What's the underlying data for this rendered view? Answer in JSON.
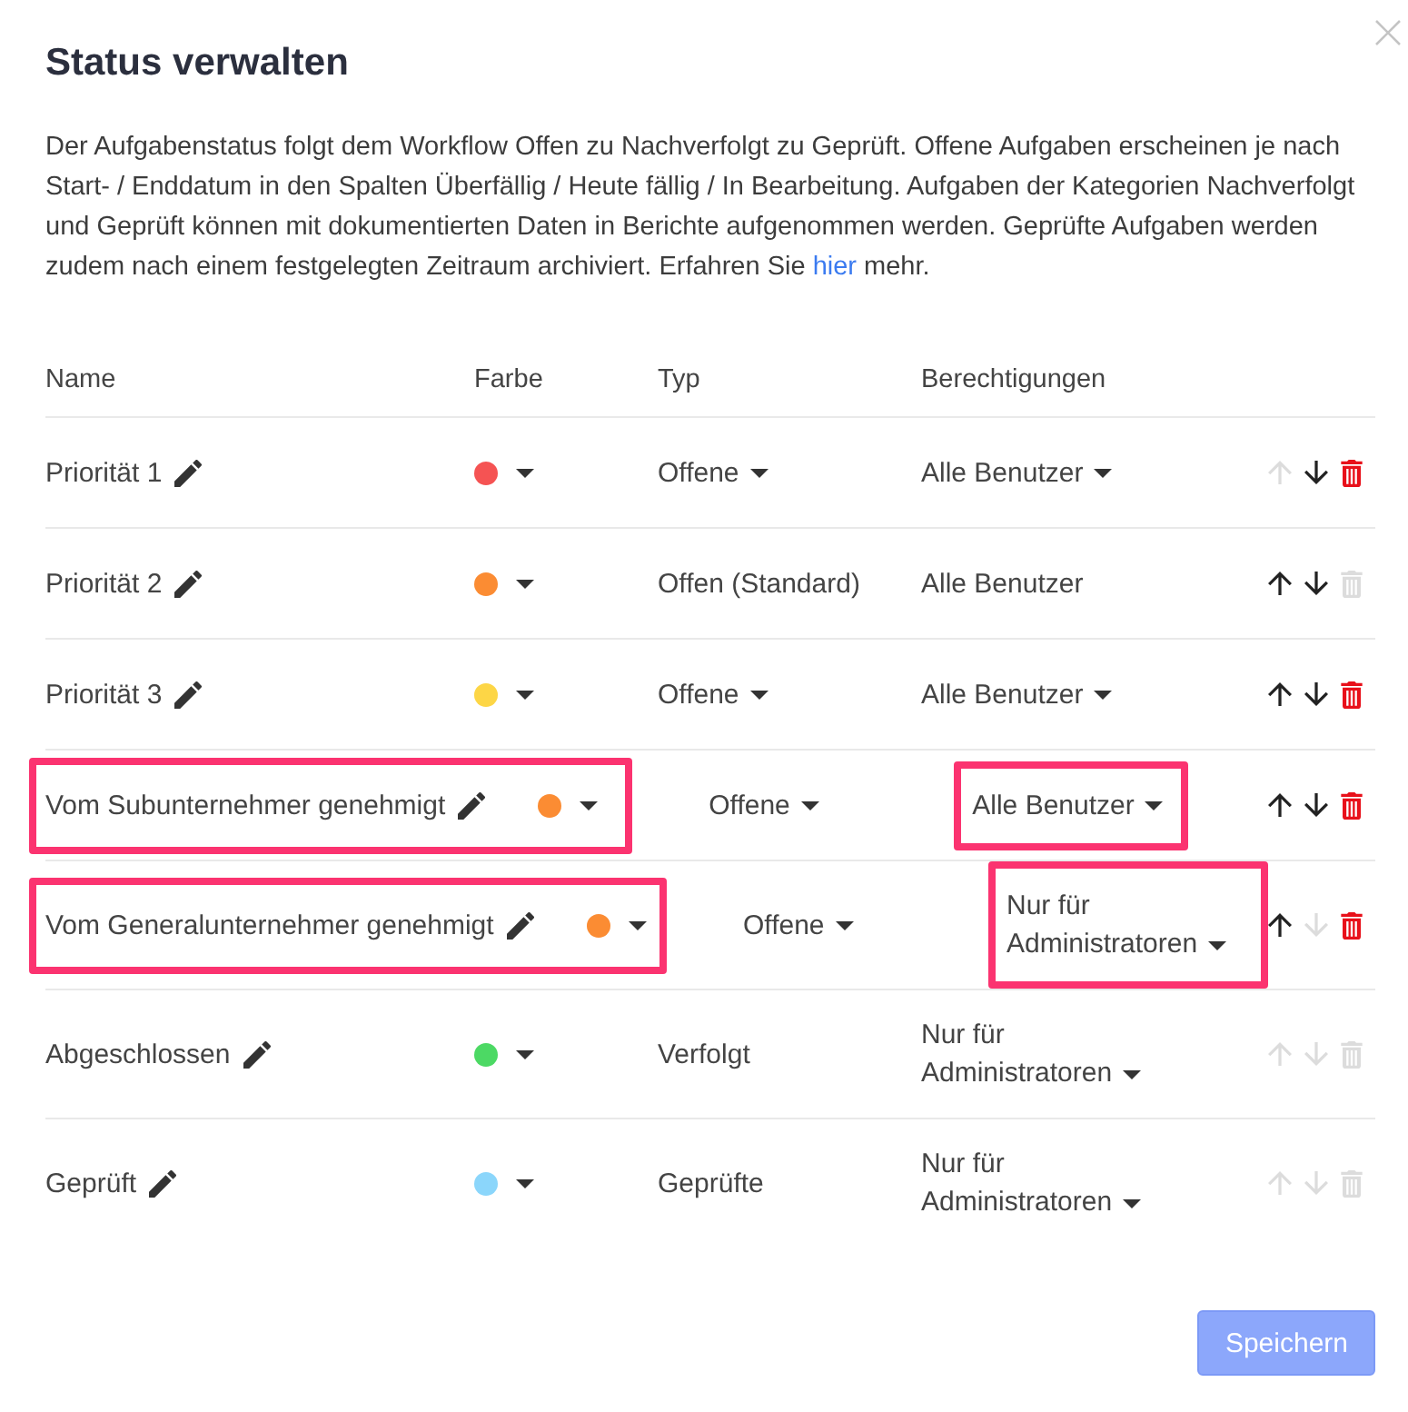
{
  "dialog": {
    "title": "Status verwalten",
    "description": {
      "text": "Der Aufgabenstatus folgt dem Workflow Offen zu Nachverfolgt zu Geprüft. Offene Aufgaben erscheinen je nach Start- / Enddatum in den Spalten Überfällig / Heute fällig / In Bearbeitung. Aufgaben der Kategorien Nachverfolgt und Geprüft können mit dokumentierten Daten in Berichte aufgenommen werden. Geprüfte Aufgaben werden zudem nach einem festgelegten Zeitraum archiviert. Erfahren Sie",
      "link": "hier",
      "text_after": "mehr."
    }
  },
  "table": {
    "columns": [
      "Name",
      "Farbe",
      "Typ",
      "Berechtigungen"
    ],
    "rows": [
      {
        "name": "Priorität 1",
        "color": "#f55353",
        "type": {
          "label": "Offene",
          "dropdown": true
        },
        "permission": {
          "label": "Alle Benutzer",
          "dropdown": true
        },
        "up_disabled": true,
        "down_disabled": false,
        "delete_disabled": false,
        "highlight_name": false,
        "highlight_permission": false
      },
      {
        "name": "Priorität 2",
        "color": "#fb8c33",
        "type": {
          "label": "Offen (Standard)",
          "dropdown": false
        },
        "permission": {
          "label": "Alle Benutzer",
          "dropdown": false
        },
        "up_disabled": false,
        "down_disabled": false,
        "delete_disabled": true,
        "highlight_name": false,
        "highlight_permission": false
      },
      {
        "name": "Priorität 3",
        "color": "#fdd646",
        "type": {
          "label": "Offene",
          "dropdown": true
        },
        "permission": {
          "label": "Alle Benutzer",
          "dropdown": true
        },
        "up_disabled": false,
        "down_disabled": false,
        "delete_disabled": false,
        "highlight_name": false,
        "highlight_permission": false
      },
      {
        "name": "Vom Subunternehmer genehmigt",
        "color": "#fb8c33",
        "type": {
          "label": "Offene",
          "dropdown": true
        },
        "permission": {
          "label": "Alle Benutzer",
          "dropdown": true
        },
        "up_disabled": false,
        "down_disabled": false,
        "delete_disabled": false,
        "highlight_name": true,
        "highlight_permission": true
      },
      {
        "name": "Vom Generalunternehmer genehmigt",
        "color": "#fb8c33",
        "type": {
          "label": "Offene",
          "dropdown": true
        },
        "permission": {
          "label": "Nur für Administratoren",
          "dropdown": true
        },
        "up_disabled": false,
        "down_disabled": true,
        "delete_disabled": false,
        "highlight_name": true,
        "highlight_permission": true
      },
      {
        "name": "Abgeschlossen",
        "color": "#4cd964",
        "type": {
          "label": "Verfolgt",
          "dropdown": false
        },
        "permission": {
          "label": "Nur für Administratoren",
          "dropdown": true
        },
        "up_disabled": true,
        "down_disabled": true,
        "delete_disabled": true,
        "highlight_name": false,
        "highlight_permission": false
      },
      {
        "name": "Geprüft",
        "color": "#8bd6fb",
        "type": {
          "label": "Geprüfte",
          "dropdown": false
        },
        "permission": {
          "label": "Nur für Administratoren",
          "dropdown": true
        },
        "up_disabled": true,
        "down_disabled": true,
        "delete_disabled": true,
        "highlight_name": false,
        "highlight_permission": false
      }
    ]
  },
  "save_button": {
    "label": "Speichern",
    "disabled": true
  }
}
